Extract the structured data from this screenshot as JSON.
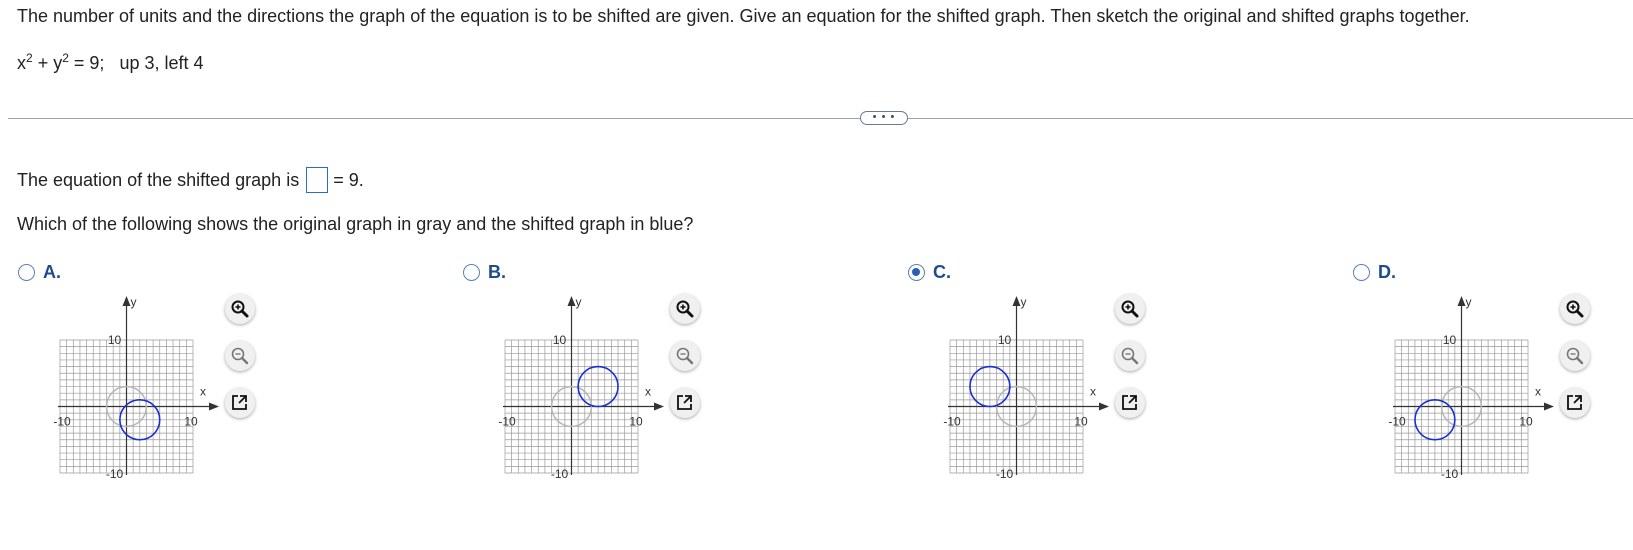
{
  "prompt": {
    "instructions": "The number of units and the directions the graph of the equation is to be shifted are given. Give an equation for the shifted graph. Then sketch the original and shifted graphs together.",
    "equation_x": "x",
    "equation_y": "y",
    "equation_exp": "2",
    "equation_rest": "= 9;",
    "shift": "up 3, left 4"
  },
  "more_button": "• • •",
  "answer": {
    "prefix": "The equation of the shifted graph is",
    "value": "",
    "suffix": "= 9."
  },
  "question": "Which of the following shows the original graph in gray and the shifted graph in blue?",
  "options": [
    {
      "letter": "A.",
      "selected": false,
      "shifted_center": [
        2,
        -2
      ],
      "shifted_radius": 3
    },
    {
      "letter": "B.",
      "selected": false,
      "shifted_center": [
        4,
        3
      ],
      "shifted_radius": 3
    },
    {
      "letter": "C.",
      "selected": true,
      "shifted_center": [
        -4,
        3
      ],
      "shifted_radius": 3
    },
    {
      "letter": "D.",
      "selected": false,
      "shifted_center": [
        -4,
        -2
      ],
      "shifted_radius": 3
    }
  ],
  "graph": {
    "min": -10,
    "max": 10,
    "tick_pos": "10",
    "tick_neg": "-10",
    "x_label": "x",
    "y_label": "y",
    "original_center": [
      0,
      0
    ],
    "original_radius": 3,
    "original_color": "#b8b8b8",
    "shifted_color": "#1a2fd0",
    "grid_color": "#9a9a9a"
  },
  "tools": [
    "zoom-in-icon",
    "zoom-out-icon",
    "open-new-window-icon"
  ]
}
